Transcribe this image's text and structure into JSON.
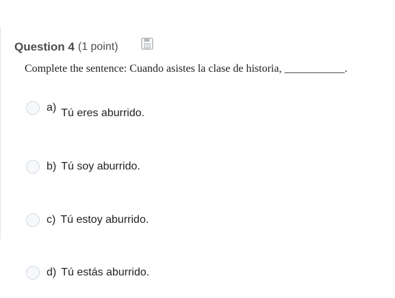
{
  "question": {
    "title": "Question 4",
    "points": "(1 point)",
    "save_icon": "save-floppy-icon",
    "prompt": "Complete the sentence: Cuando asistes la clase de historia, ___________."
  },
  "options": [
    {
      "letter": "a)",
      "text": "Tú eres aburrido."
    },
    {
      "letter": "b)",
      "text": "Tú soy aburrido."
    },
    {
      "letter": "c)",
      "text": "Tú estoy aburrido."
    },
    {
      "letter": "d)",
      "text": "Tú estás aburrido."
    }
  ],
  "colors": {
    "text": "#494c4e",
    "radio_border": "#d3d9e3",
    "radio_fill": "#f7f8f9"
  }
}
